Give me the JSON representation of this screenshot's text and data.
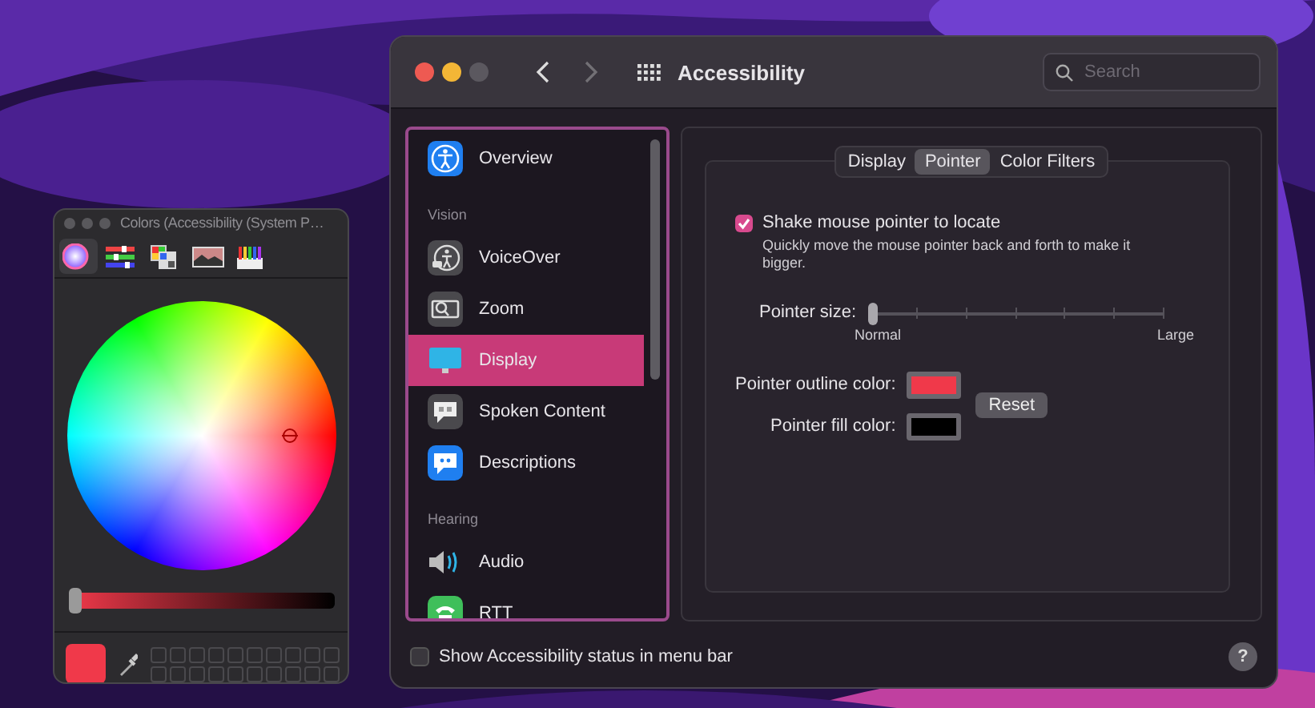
{
  "colors_window": {
    "title": "Colors (Accessibility (System P…",
    "modes": [
      {
        "selected": true
      },
      {
        "selected": false
      },
      {
        "selected": false
      },
      {
        "selected": false
      },
      {
        "selected": false
      }
    ],
    "brightness": {
      "level": 0
    },
    "current_color": {
      "color": "#f0394a"
    }
  },
  "window": {
    "title": "Accessibility",
    "search": {
      "placeholder": "Search"
    },
    "nav_buttons": [
      {
        "disabled": false
      },
      {
        "disabled": true
      }
    ],
    "sidebar": {
      "sections": [
        {
          "items": [
            {
              "label": "Overview",
              "selected": false
            }
          ]
        },
        {
          "heading": "Vision",
          "items": [
            {
              "label": "VoiceOver",
              "selected": false
            },
            {
              "label": "Zoom",
              "selected": false
            },
            {
              "label": "Display",
              "selected": true
            },
            {
              "label": "Spoken Content",
              "selected": false
            },
            {
              "label": "Descriptions",
              "selected": false
            }
          ]
        },
        {
          "heading": "Hearing",
          "items": [
            {
              "label": "Audio",
              "selected": false
            },
            {
              "label": "RTT",
              "selected": false
            }
          ]
        }
      ]
    },
    "tabs": [
      {
        "label": "Display",
        "selected": false
      },
      {
        "label": "Pointer",
        "selected": true
      },
      {
        "label": "Color Filters",
        "selected": false
      }
    ],
    "pointer": {
      "shake": {
        "label": "Shake mouse pointer to locate",
        "checked": true,
        "description": "Quickly move the mouse pointer back and forth to make it bigger."
      },
      "size": {
        "label": "Pointer size:",
        "level": 0,
        "min_label": "Normal",
        "max_label": "Large"
      },
      "outline": {
        "label": "Pointer outline color:",
        "color": "#f0394a"
      },
      "fill": {
        "label": "Pointer fill color:",
        "color": "#000000"
      },
      "reset": "Reset"
    },
    "status_item": {
      "label": "Show Accessibility status in menu bar",
      "checked": false
    },
    "help": "?"
  }
}
